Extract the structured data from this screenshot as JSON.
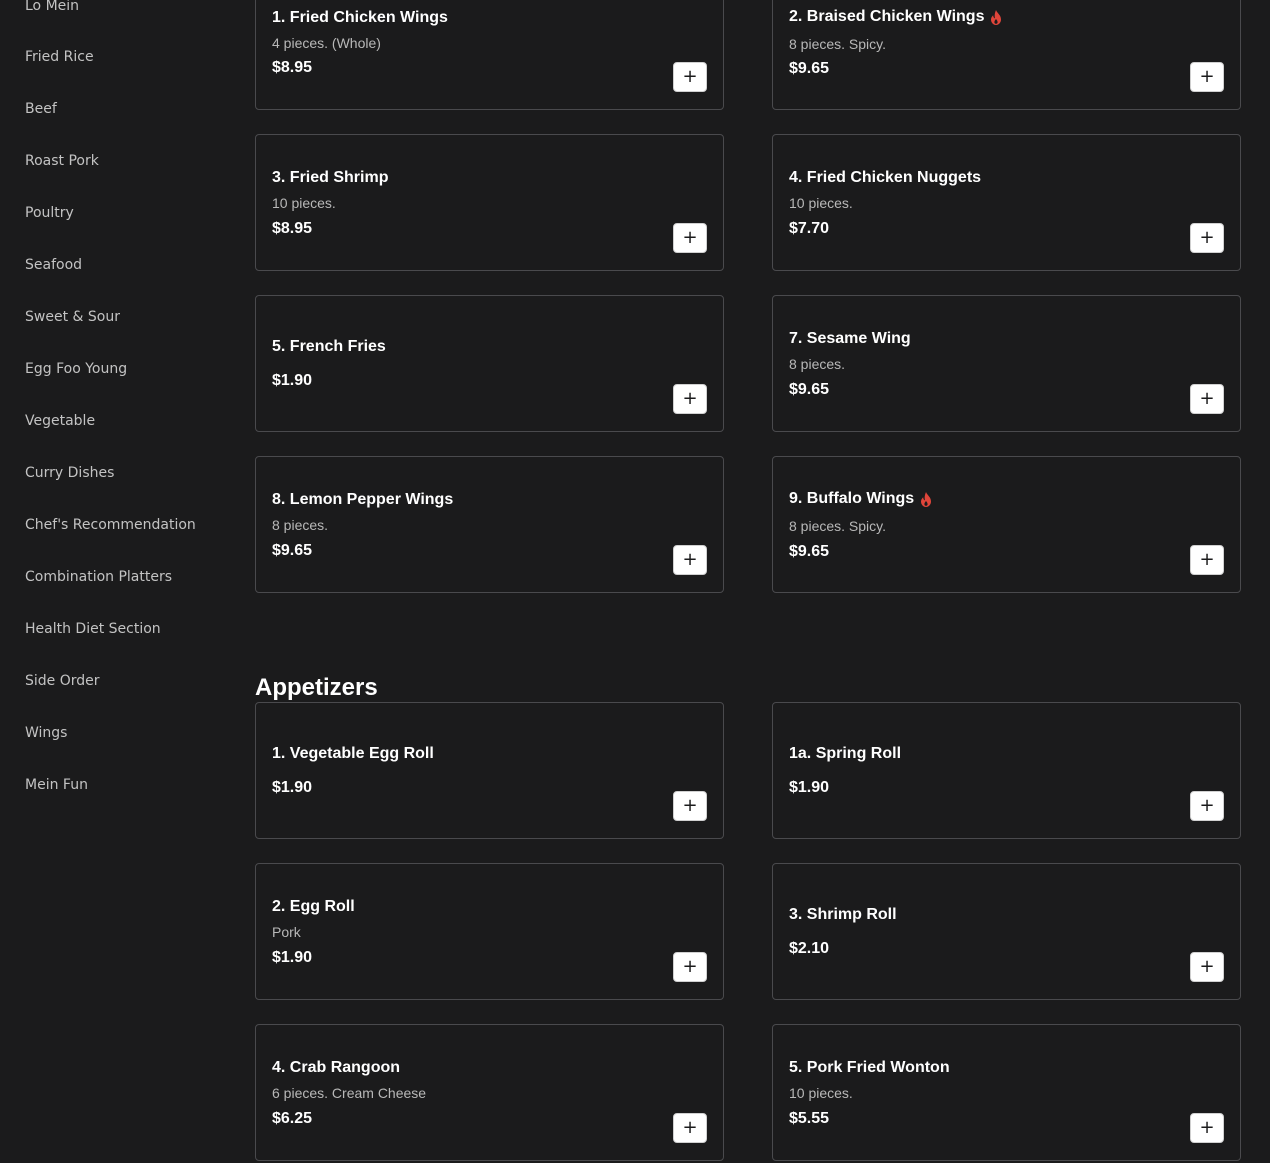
{
  "sidebar": {
    "items": [
      {
        "label": "Lo Mein"
      },
      {
        "label": "Fried Rice"
      },
      {
        "label": "Beef"
      },
      {
        "label": "Roast Pork"
      },
      {
        "label": "Poultry"
      },
      {
        "label": "Seafood"
      },
      {
        "label": "Sweet & Sour"
      },
      {
        "label": "Egg Foo Young"
      },
      {
        "label": "Vegetable"
      },
      {
        "label": "Curry Dishes"
      },
      {
        "label": "Chef's Recommendation"
      },
      {
        "label": "Combination Platters"
      },
      {
        "label": "Health Diet Section"
      },
      {
        "label": "Side Order"
      },
      {
        "label": "Wings"
      },
      {
        "label": "Mein Fun"
      }
    ]
  },
  "wings": {
    "items": [
      {
        "name": "1. Fried Chicken Wings",
        "desc": "4 pieces. (Whole)",
        "price": "$8.95",
        "spicy": false
      },
      {
        "name": "2. Braised Chicken Wings",
        "desc": "8 pieces. Spicy.",
        "price": "$9.65",
        "spicy": true
      },
      {
        "name": "3. Fried Shrimp",
        "desc": "10 pieces.",
        "price": "$8.95",
        "spicy": false
      },
      {
        "name": "4. Fried Chicken Nuggets",
        "desc": "10 pieces.",
        "price": "$7.70",
        "spicy": false
      },
      {
        "name": "5. French Fries",
        "desc": "",
        "price": "$1.90",
        "spicy": false
      },
      {
        "name": "7. Sesame Wing",
        "desc": "8 pieces.",
        "price": "$9.65",
        "spicy": false
      },
      {
        "name": "8. Lemon Pepper Wings",
        "desc": "8 pieces.",
        "price": "$9.65",
        "spicy": false
      },
      {
        "name": "9. Buffalo Wings",
        "desc": "8 pieces. Spicy.",
        "price": "$9.65",
        "spicy": true
      }
    ]
  },
  "appetizers": {
    "title": "Appetizers",
    "items": [
      {
        "name": "1. Vegetable Egg Roll",
        "desc": "",
        "price": "$1.90"
      },
      {
        "name": "1a. Spring Roll",
        "desc": "",
        "price": "$1.90"
      },
      {
        "name": "2. Egg Roll",
        "desc": "Pork",
        "price": "$1.90"
      },
      {
        "name": "3. Shrimp Roll",
        "desc": "",
        "price": "$2.10"
      },
      {
        "name": "4. Crab Rangoon",
        "desc": "6 pieces. Cream Cheese",
        "price": "$6.25"
      },
      {
        "name": "5. Pork Fried Wonton",
        "desc": "10 pieces.",
        "price": "$5.55"
      }
    ]
  },
  "add_button": {
    "symbol": "+"
  },
  "colors": {
    "background": "#1b1b1c",
    "card_border": "#4a4a4d",
    "spicy": "#e0453a",
    "sidebar_text": "#c3c3c3"
  }
}
